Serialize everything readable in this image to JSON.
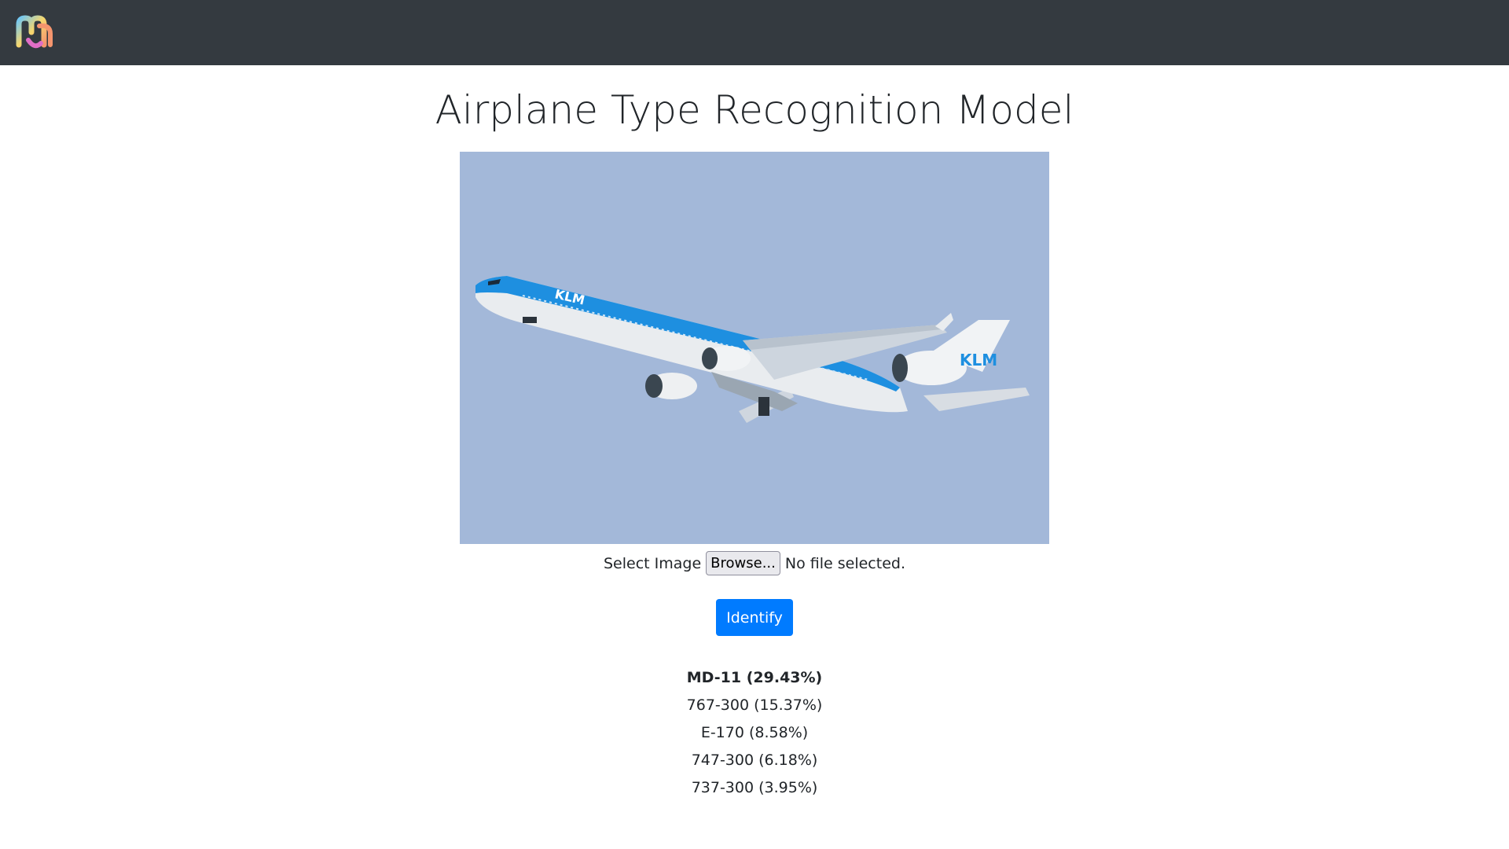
{
  "navbar": {
    "logo_icon": "app-logo-icon"
  },
  "page": {
    "title": "Airplane Type Recognition Model"
  },
  "preview_image": {
    "alt": "KLM airplane photo",
    "sky_color": "#a3b8d9",
    "body_blue": "#1e90e0",
    "livery_text": "KLM"
  },
  "upload": {
    "label": "Select Image",
    "browse_label": "Browse...",
    "status": "No file selected."
  },
  "identify_button": {
    "label": "Identify",
    "color": "#007bff"
  },
  "results": [
    {
      "label": "MD-11 (29.43%)"
    },
    {
      "label": "767-300 (15.37%)"
    },
    {
      "label": "E-170 (8.58%)"
    },
    {
      "label": "747-300 (6.18%)"
    },
    {
      "label": "737-300 (3.95%)"
    }
  ]
}
